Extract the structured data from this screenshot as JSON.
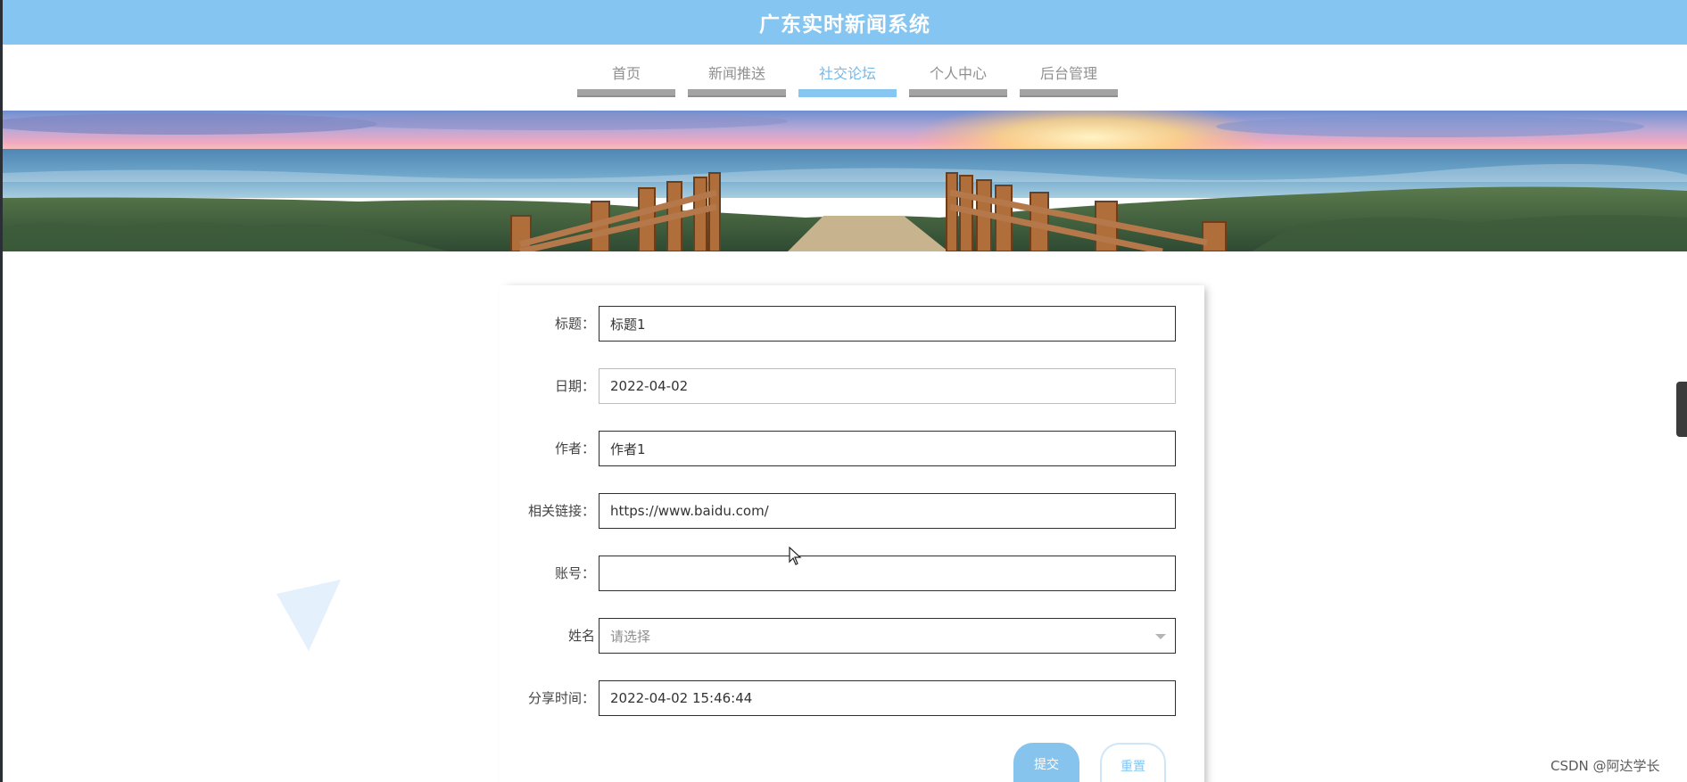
{
  "app": {
    "title": "广东实时新闻系统"
  },
  "nav": {
    "items": [
      {
        "label": "首页",
        "active": false
      },
      {
        "label": "新闻推送",
        "active": false
      },
      {
        "label": "社交论坛",
        "active": true
      },
      {
        "label": "个人中心",
        "active": false
      },
      {
        "label": "后台管理",
        "active": false
      }
    ]
  },
  "form": {
    "fields": [
      {
        "label": "标题：",
        "value": "标题1"
      },
      {
        "label": "日期：",
        "value": "2022-04-02"
      },
      {
        "label": "作者：",
        "value": "作者1"
      },
      {
        "label": "相关链接：",
        "value": "https://www.baidu.com/"
      },
      {
        "label": "账号：",
        "value": ""
      },
      {
        "label": "姓名",
        "value": "",
        "placeholder": "请选择"
      },
      {
        "label": "分享时间：",
        "value": "2022-04-02 15:46:44"
      }
    ],
    "submit_label": "提交",
    "reset_label": "重置"
  },
  "watermark": "CSDN @阿达学长",
  "colors": {
    "accent": "#85c5f1",
    "nav_inactive_bar": "#a3a3a3",
    "triangle": "#e4f0fb"
  },
  "icons": {
    "select_caret": "chevron-down-icon",
    "mouse_cursor": "cursor-arrow-icon"
  }
}
